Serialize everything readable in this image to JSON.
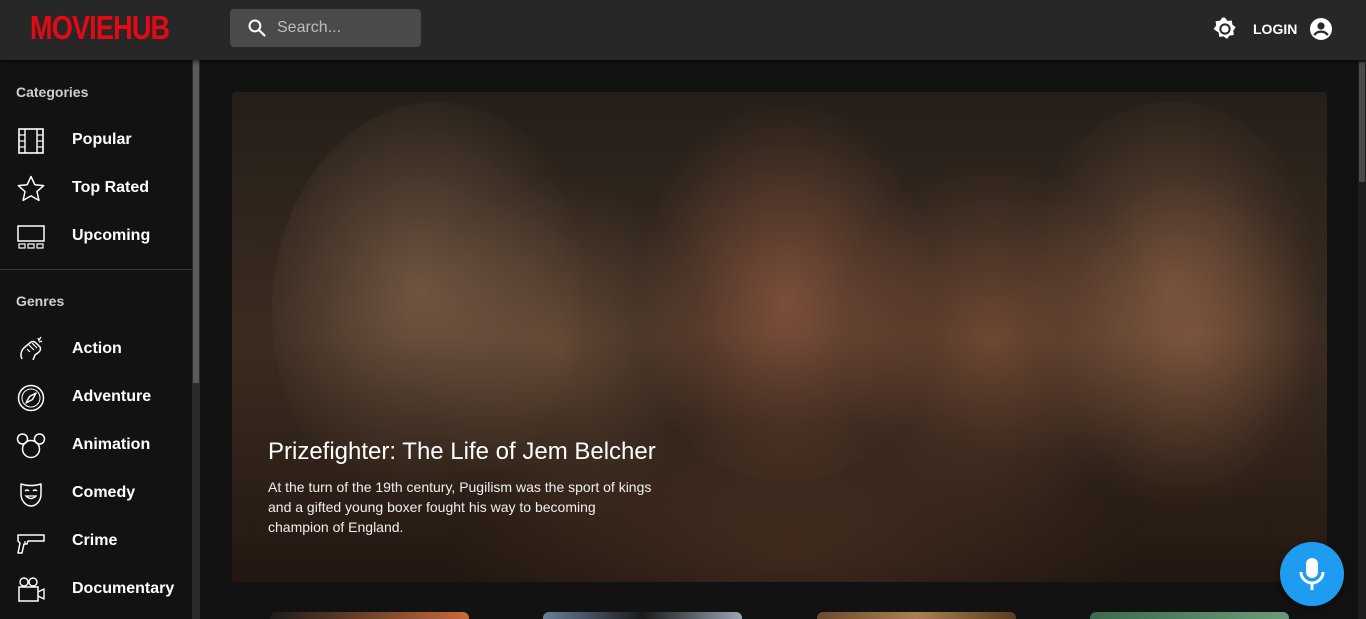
{
  "app": {
    "logo_text": "MOVIEHUB",
    "brand_color": "#e50914",
    "accent_color": "#1e9df0"
  },
  "header": {
    "search_placeholder": "Search...",
    "login_label": "LOGIN",
    "theme_icon": "brightness-icon",
    "account_icon": "account-circle-icon"
  },
  "sidebar": {
    "categories_title": "Categories",
    "categories": [
      {
        "label": "Popular",
        "icon": "film-icon"
      },
      {
        "label": "Top Rated",
        "icon": "star-icon"
      },
      {
        "label": "Upcoming",
        "icon": "theater-icon"
      }
    ],
    "genres_title": "Genres",
    "genres": [
      {
        "label": "Action",
        "icon": "action-icon"
      },
      {
        "label": "Adventure",
        "icon": "compass-icon"
      },
      {
        "label": "Animation",
        "icon": "mouse-ears-icon"
      },
      {
        "label": "Comedy",
        "icon": "comedy-mask-icon"
      },
      {
        "label": "Crime",
        "icon": "gun-icon"
      },
      {
        "label": "Documentary",
        "icon": "video-camera-icon"
      }
    ]
  },
  "featured": {
    "title": "Prizefighter: The Life of Jem Belcher",
    "description": "At the turn of the 19th century, Pugilism was the sport of kings and a gifted young boxer fought his way to becoming champion of England."
  },
  "voice_button": {
    "icon": "microphone-icon"
  }
}
